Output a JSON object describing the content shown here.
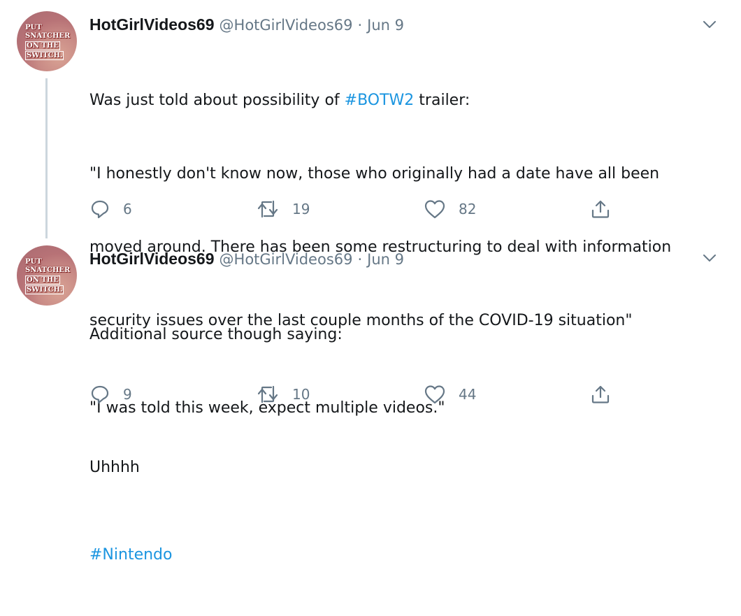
{
  "tweets": [
    {
      "display_name": "HotGirlVideos69",
      "handle": "@HotGirlVideos69",
      "separator": "·",
      "date": "Jun 9",
      "avatar_text": [
        "PUT",
        "SNATCHER",
        "ON THE",
        "SWITCH."
      ],
      "text": {
        "line1_before": "Was just told about possibility of ",
        "line1_hashtag": "#BOTW2",
        "line1_after": " trailer:",
        "line2": "\"I honestly don't know now, those who originally had a date have all been",
        "line3": "moved around. There has been some restructuring to deal with information",
        "line4": "security issues over the last couple months of the COVID-19 situation\"",
        "line6": "Uhhhh"
      },
      "counts": {
        "replies": "6",
        "retweets": "19",
        "likes": "82"
      }
    },
    {
      "display_name": "HotGirlVideos69",
      "handle": "@HotGirlVideos69",
      "separator": "·",
      "date": "Jun 9",
      "avatar_text": [
        "PUT",
        "SNATCHER",
        "ON THE",
        "SWITCH."
      ],
      "text": {
        "line1": "Additional source though saying:",
        "line2": "\"I was told this week, expect multiple videos.\"",
        "line4_hashtag": "#Nintendo"
      },
      "counts": {
        "replies": "9",
        "retweets": "10",
        "likes": "44"
      }
    }
  ],
  "colors": {
    "text": "#14171a",
    "secondary": "#657786",
    "link": "#1b95e0",
    "thread_line": "#ccd6dd"
  },
  "icons": [
    "chevron-down-icon",
    "reply-icon",
    "retweet-icon",
    "like-icon",
    "share-icon"
  ]
}
